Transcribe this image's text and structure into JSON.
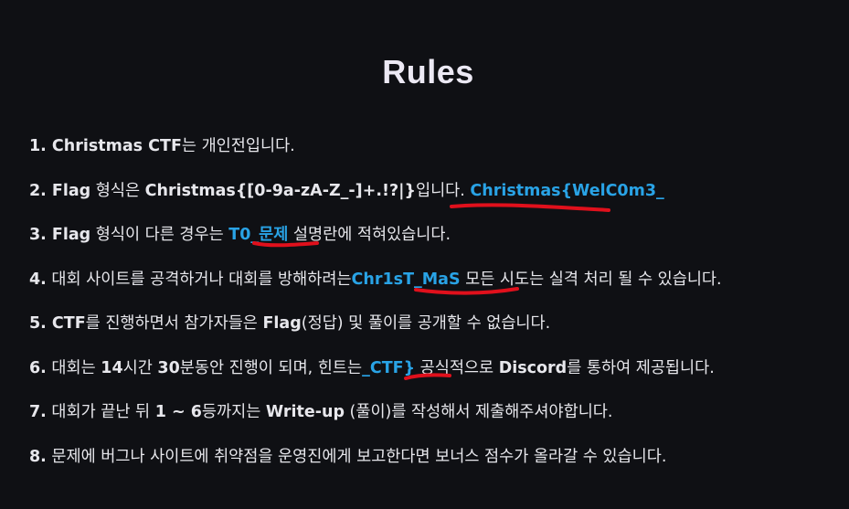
{
  "title": "Rules",
  "rules": [
    {
      "num": "1.",
      "parts": [
        {
          "t": "Christmas CTF",
          "b": true
        },
        {
          "t": "는 개인전입니다."
        }
      ]
    },
    {
      "num": "2.",
      "parts": [
        {
          "t": "Flag",
          "b": true
        },
        {
          "t": " 형식은 "
        },
        {
          "t": "Christmas{[0-9a-zA-Z_-]+.!?|}",
          "b": true
        },
        {
          "t": "입니다. "
        },
        {
          "t": "Christmas{WelC0m3_",
          "hl": true
        }
      ]
    },
    {
      "num": "3.",
      "parts": [
        {
          "t": "Flag",
          "b": true
        },
        {
          "t": " 형식이 다른 경우는 "
        },
        {
          "t": "T0_문제",
          "hl": true
        },
        {
          "t": " 설명란에 적혀있습니다."
        }
      ]
    },
    {
      "num": "4.",
      "parts": [
        {
          "t": " 대회 사이트를 공격하거나 대회를 방해하려는"
        },
        {
          "t": "Chr1sT_MaS",
          "hl": true
        },
        {
          "t": " 모든 시도는 실격 처리 될 수 있습니다."
        }
      ]
    },
    {
      "num": "5.",
      "parts": [
        {
          "t": "CTF",
          "b": true
        },
        {
          "t": "를 진행하면서 참가자들은 "
        },
        {
          "t": "Flag",
          "b": true
        },
        {
          "t": "(정답) 및 풀이를 공개할 수 없습니다."
        }
      ]
    },
    {
      "num": "6.",
      "parts": [
        {
          "t": " 대회는 "
        },
        {
          "t": "14",
          "b": true
        },
        {
          "t": "시간 "
        },
        {
          "t": "30",
          "b": true
        },
        {
          "t": "분동안 진행이 되며, 힌트는"
        },
        {
          "t": "_CTF}",
          "hl": true
        },
        {
          "t": " 공식적으로 "
        },
        {
          "t": "Discord",
          "b": true
        },
        {
          "t": "를 통하여 제공됩니다."
        }
      ]
    },
    {
      "num": "7.",
      "parts": [
        {
          "t": " 대회가 끝난 뒤 "
        },
        {
          "t": "1 ~ 6",
          "b": true
        },
        {
          "t": "등까지는 "
        },
        {
          "t": "Write-up",
          "b": true
        },
        {
          "t": " (풀이)를 작성해서 제출해주셔야합니다."
        }
      ]
    },
    {
      "num": "8.",
      "parts": [
        {
          "t": " 문제에 버그나 사이트에 취약점을 운영진에게 보고한다면 보너스 점수가 올라갈 수 있습니다."
        }
      ]
    }
  ],
  "annotation_color": "#e0101c",
  "highlight_color": "#29a3e6"
}
